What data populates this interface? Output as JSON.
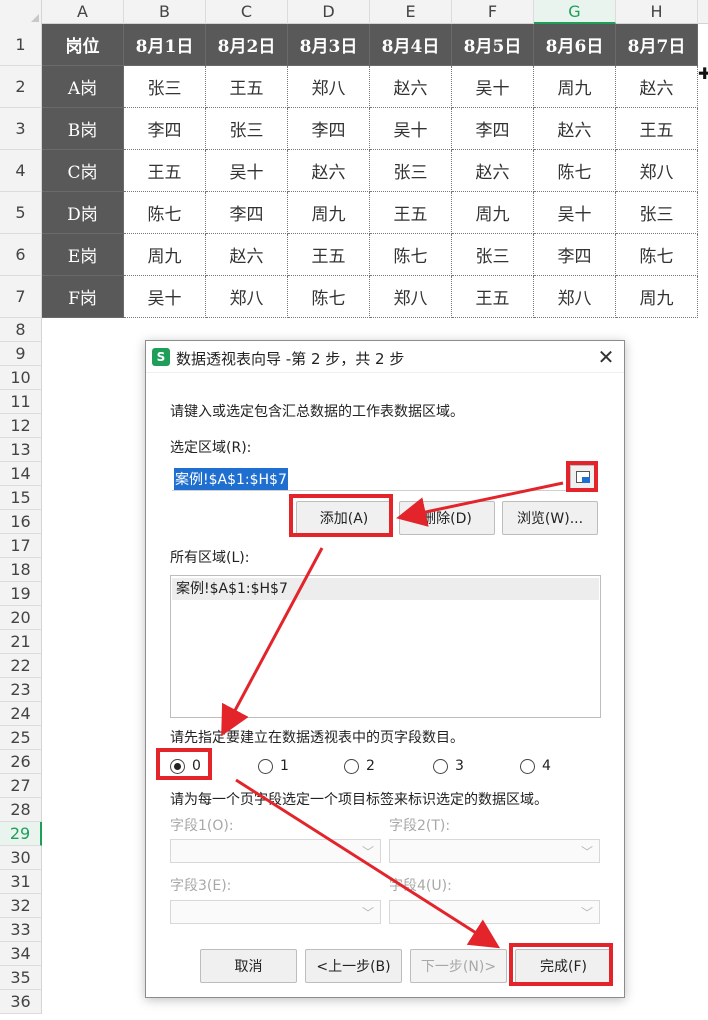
{
  "spreadsheet": {
    "columns": [
      "A",
      "B",
      "C",
      "D",
      "E",
      "F",
      "G",
      "H"
    ],
    "selected_column": "G",
    "rows": [
      "1",
      "2",
      "3",
      "4",
      "5",
      "6",
      "7",
      "8",
      "9",
      "10",
      "11",
      "12",
      "13",
      "14",
      "15",
      "16",
      "17",
      "18",
      "19",
      "20",
      "21",
      "22",
      "23",
      "24",
      "25",
      "26",
      "27",
      "28",
      "29",
      "30",
      "31",
      "32",
      "33",
      "34",
      "35",
      "36"
    ],
    "selected_row": "29",
    "table": {
      "header": [
        "岗位",
        "8月1日",
        "8月2日",
        "8月3日",
        "8月4日",
        "8月5日",
        "8月6日",
        "8月7日"
      ],
      "body": [
        [
          "A岗",
          "张三",
          "王五",
          "郑八",
          "赵六",
          "吴十",
          "周九",
          "赵六"
        ],
        [
          "B岗",
          "李四",
          "张三",
          "李四",
          "吴十",
          "李四",
          "赵六",
          "王五"
        ],
        [
          "C岗",
          "王五",
          "吴十",
          "赵六",
          "张三",
          "赵六",
          "陈七",
          "郑八"
        ],
        [
          "D岗",
          "陈七",
          "李四",
          "周九",
          "王五",
          "周九",
          "吴十",
          "张三"
        ],
        [
          "E岗",
          "周九",
          "赵六",
          "王五",
          "陈七",
          "张三",
          "李四",
          "陈七"
        ],
        [
          "F岗",
          "吴十",
          "郑八",
          "陈七",
          "郑八",
          "王五",
          "郑八",
          "周九"
        ]
      ]
    }
  },
  "dialog": {
    "app_icon": "S",
    "title": "数据透视表向导 -第 2 步，共 2 步",
    "close": "✕",
    "instruction": "请键入或选定包含汇总数据的工作表数据区域。",
    "range_label": "选定区域(R):",
    "range_value": "案例!$A$1:$H$7",
    "add_button": "添加(A)",
    "delete_button": "删除(D)",
    "browse_button": "浏览(W)...",
    "all_ranges_label": "所有区域(L):",
    "all_ranges": [
      "案例!$A$1:$H$7"
    ],
    "page_fields_prompt": "请先指定要建立在数据透视表中的页字段数目。",
    "page_field_options": [
      "0",
      "1",
      "2",
      "3",
      "4"
    ],
    "page_field_selected": "0",
    "label_prompt": "请为每一个页字段选定一个项目标签来标识选定的数据区域。",
    "field1_label": "字段1(O):",
    "field2_label": "字段2(T):",
    "field3_label": "字段3(E):",
    "field4_label": "字段4(U):",
    "cancel_button": "取消",
    "back_button": "<上一步(B)",
    "next_button": "下一步(N)>",
    "finish_button": "完成(F)"
  },
  "colors": {
    "header_fill": "#595959",
    "accent_green": "#1f9e5a",
    "annotation_red": "#e3242b",
    "selection_blue": "#1f6fd1"
  }
}
